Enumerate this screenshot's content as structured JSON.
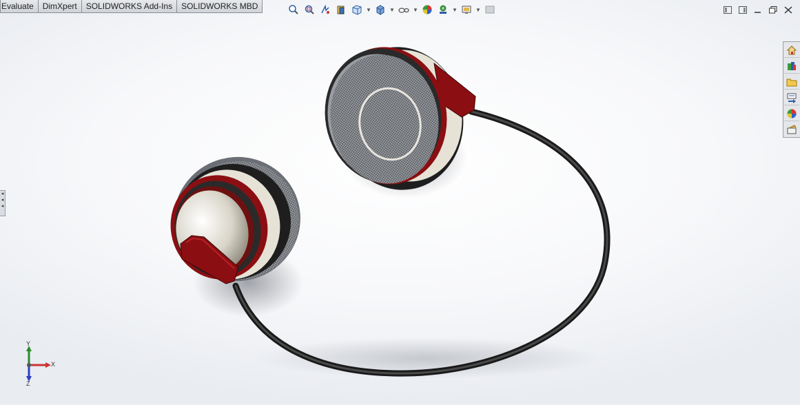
{
  "tabs": [
    "Evaluate",
    "DimXpert",
    "SOLIDWORKS Add-Ins",
    "SOLIDWORKS MBD"
  ],
  "hud_toolbar": [
    {
      "icon": "zoom-to-fit-icon"
    },
    {
      "icon": "zoom-to-area-icon"
    },
    {
      "icon": "previous-view-icon"
    },
    {
      "icon": "section-view-icon"
    },
    {
      "icon": "view-orientation-icon"
    },
    {
      "icon": "display-style-icon"
    },
    {
      "icon": "hide-show-items-icon"
    },
    {
      "icon": "edit-appearance-icon"
    },
    {
      "icon": "apply-scene-icon"
    },
    {
      "icon": "view-settings-icon"
    },
    {
      "icon": "monitor-icon"
    }
  ],
  "window_controls": [
    "tile-horizontal-icon",
    "tile-vertical-icon",
    "minimize-icon",
    "restore-icon",
    "close-icon"
  ],
  "task_pane": [
    "solidworks-resources-icon",
    "design-library-icon",
    "file-explorer-icon",
    "view-palette-icon",
    "appearances-scenes-icon",
    "custom-properties-icon"
  ],
  "triad": {
    "x_label": "X",
    "y_label": "Y",
    "z_label": "Z"
  },
  "colors": {
    "earcup_red": "#8b0f12",
    "cushion_gray": "#6b6e74",
    "cable": "#2a2a2a",
    "inner_cream": "#e6e2d6"
  }
}
